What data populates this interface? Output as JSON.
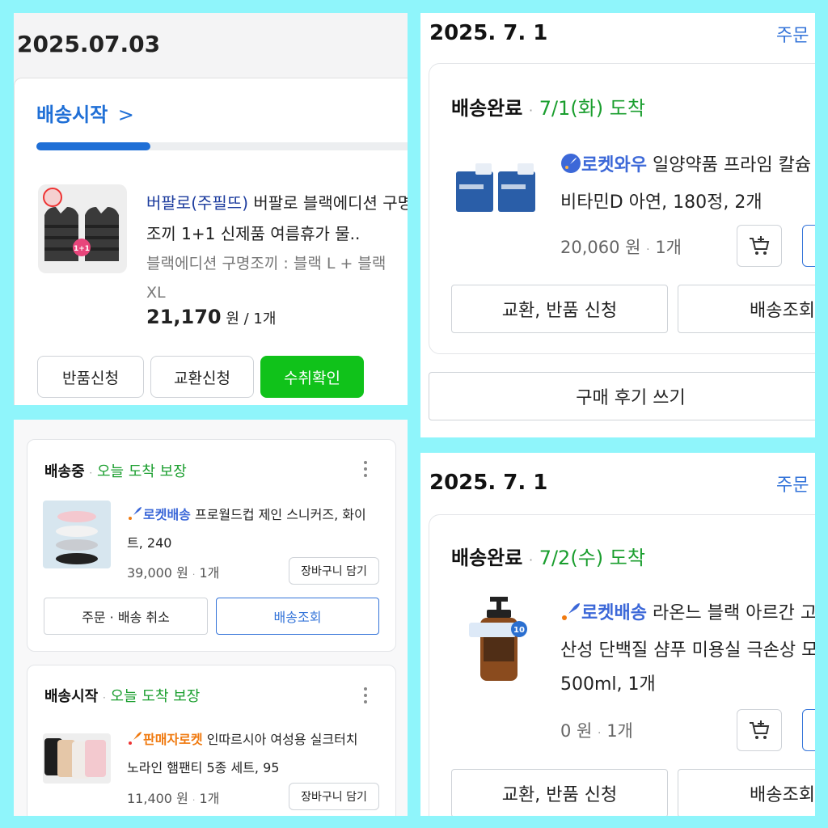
{
  "p1": {
    "date": "2025.07.03",
    "status": "배송시작",
    "chevron": ">",
    "progress": 0.3,
    "seller": "버팔로(주필뜨)",
    "title_rest": " 버팔로 블랙에디션 구명조끼 1+1 신제품 여름휴가 물..",
    "option": "블랙에디션 구명조끼 : 블랙 L + 블랙 XL",
    "price": "21,170",
    "price_unit": "원 / 1개",
    "badge": "1+1",
    "btn_return": "반품신청",
    "btn_exchange": "교환신청",
    "btn_confirm": "수취확인"
  },
  "p2": {
    "date": "2025. 7. 1",
    "order_link": "주문",
    "status": "배송완료",
    "sep": "·",
    "arrival": "7/1(화) 도착",
    "brand": "로켓와우",
    "title_l1": " 일양약품 프라임 칼슘",
    "title_l2": "비타민D 아연, 180정, 2개",
    "price": "20,060 원",
    "qty": "1개",
    "btn_exchange": "교환, 반품 신청",
    "btn_track": "배송조회",
    "btn_review": "구매 후기 쓰기"
  },
  "p3": {
    "card1": {
      "status": "배송중",
      "sep": "·",
      "arrival": "오늘 도착 보장",
      "brand": "로켓배송",
      "title_l1": " 프로월드컵 제인 스니커즈, 화이",
      "title_l2": "트, 240",
      "price": "39,000 원",
      "qty": "1개",
      "btn_cart": "장바구니 담기",
      "btn_cancel": "주문 · 배송 취소",
      "btn_track": "배송조회"
    },
    "card2": {
      "status": "배송시작",
      "sep": "·",
      "arrival": "오늘 도착 보장",
      "brand": "판매자로켓",
      "title_l1": " 인따르시아 여성용 실크터치",
      "title_l2": "노라인 햄팬티 5종 세트, 95",
      "price": "11,400 원",
      "qty": "1개",
      "btn_cart": "장바구니 담기"
    }
  },
  "p4": {
    "date": "2025. 7. 1",
    "order_link": "주문",
    "status": "배송완료",
    "sep": "·",
    "arrival": "7/2(수) 도착",
    "brand": "로켓배송",
    "title_l1": " 라온느 블랙 아르간 고",
    "title_l2": "산성 단백질 샴푸 미용실 극손상 모",
    "title_l3": "500ml, 1개",
    "price": "0 원",
    "qty": "1개",
    "bottle_label": "10",
    "btn_exchange": "교환, 반품 신청",
    "btn_track": "배송조회"
  },
  "colors": {
    "background": "#8ff5fb",
    "accent_blue": "#1f6fd6",
    "green": "#1a9e2e",
    "confirm_green": "#10c21a",
    "seller_blue": "#1d3c9e",
    "rocket_orange": "#f07a10"
  },
  "icons": [
    "chevron-right-icon",
    "rocket-icon",
    "cart-add-icon",
    "more-vertical-icon"
  ]
}
